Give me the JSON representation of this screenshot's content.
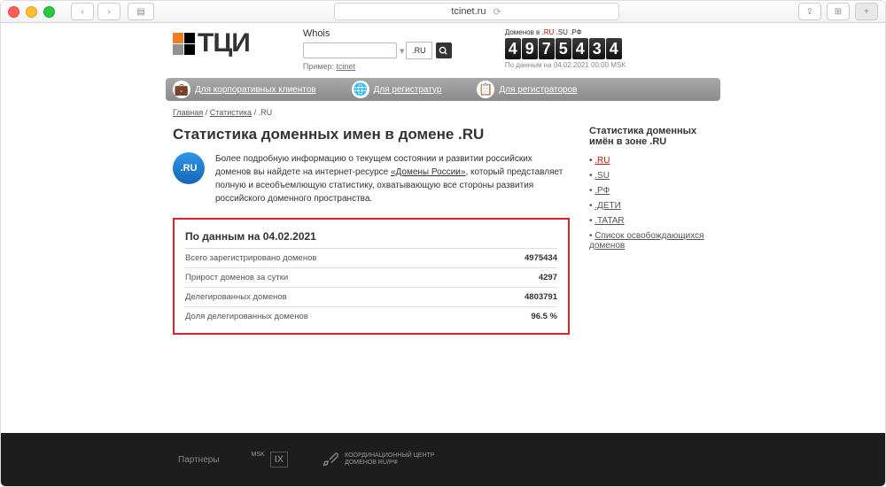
{
  "browser": {
    "url": "tcinet.ru",
    "traffic_lights": [
      "close",
      "min",
      "max"
    ]
  },
  "logo_text": "ТЦИ",
  "whois": {
    "label": "Whois",
    "tld": ".RU",
    "example_prefix": "Пример:",
    "example_value": "tcinet"
  },
  "counter": {
    "prefix": "Доменов в ",
    "ru": ".RU",
    "su": ".SU",
    "rf": ".РФ",
    "digits": [
      "4",
      "9",
      "7",
      "5",
      "4",
      "3",
      "4"
    ],
    "sub": "По данным на 04.02.2021 00:00 MSK"
  },
  "nav": [
    {
      "icon": "💼",
      "label": "Для корпоративных клиентов"
    },
    {
      "icon": "🌐",
      "label": "Для регистратур"
    },
    {
      "icon": "📋",
      "label": "Для регистраторов"
    }
  ],
  "breadcrumb": [
    "Главная",
    "Статистика",
    ".RU"
  ],
  "title": "Статистика доменных имен в домене .RU",
  "ru_badge": ".RU",
  "intro": {
    "p1a": "Более подробную информацию о текущем состоянии и развитии российских доменов вы найдете на интернет-ресурсе ",
    "link": "«Домены России»",
    "p1b": ", который представляет полную и всеобъемлющую статистику, охватывающую все стороны развития российского доменного пространства."
  },
  "stats": {
    "heading": "По данным на 04.02.2021",
    "rows": [
      {
        "label": "Всего зарегистрировано доменов",
        "value": "4975434"
      },
      {
        "label": "Прирост доменов за сутки",
        "value": "4297"
      },
      {
        "label": "Делегированных доменов",
        "value": "4803791"
      },
      {
        "label": "Доля делегированных доменов",
        "value": "96.5 %"
      }
    ]
  },
  "sidebar": {
    "heading": "Статистика доменных имён в зоне .RU",
    "items": [
      {
        "label": ".RU",
        "active": true
      },
      {
        "label": ".SU"
      },
      {
        "label": ".РФ"
      },
      {
        "label": ".ДЕТИ"
      },
      {
        "label": ".TATAR"
      },
      {
        "label": "Список освобождающихся доменов"
      }
    ]
  },
  "footer": {
    "label": "Партнеры",
    "p1_top": "MSK",
    "p1_main": "IX",
    "p2": "КООРДИНАЦИОННЫЙ ЦЕНТР\nДОМЕНОВ RU/РФ"
  }
}
